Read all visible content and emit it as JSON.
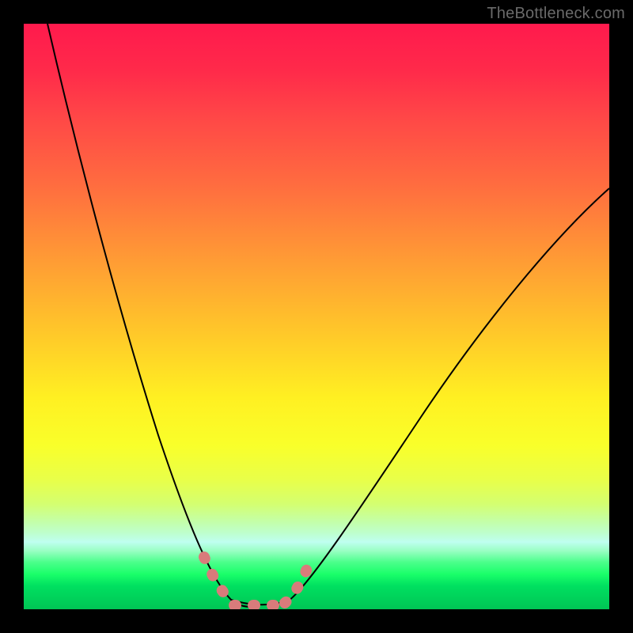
{
  "watermark": "TheBottleneck.com",
  "colors": {
    "frame": "#000000",
    "curve": "#000000",
    "highlight": "#d97b7b",
    "gradient_top": "#ff1a4d",
    "gradient_mid": "#fff022",
    "gradient_bottom": "#00c555"
  },
  "chart_data": {
    "type": "line",
    "title": "",
    "xlabel": "",
    "ylabel": "",
    "xlim": [
      0,
      100
    ],
    "ylim": [
      0,
      100
    ],
    "grid": false,
    "legend_position": "none",
    "notes": "Bottleneck-style V-curve on vertical red-to-green gradient. Y≈0 (green) indicates minimal bottleneck. Highlighted zone marks the near-zero flat region around x≈32–44. No axis ticks or numeric labels are rendered in the image; x/y values below are estimated from pixel geometry on a 0–100 normalized scale.",
    "series": [
      {
        "name": "left-curve",
        "x": [
          4,
          7,
          10,
          13,
          17,
          21,
          25,
          29,
          32,
          34,
          36
        ],
        "y": [
          100,
          90,
          78,
          65,
          50,
          36,
          22,
          11,
          4,
          1.5,
          0.5
        ]
      },
      {
        "name": "valley-flat",
        "x": [
          36,
          38,
          40,
          42,
          44
        ],
        "y": [
          0.5,
          0.3,
          0.3,
          0.3,
          0.5
        ]
      },
      {
        "name": "right-curve",
        "x": [
          44,
          48,
          54,
          60,
          68,
          76,
          84,
          92,
          100
        ],
        "y": [
          0.5,
          3,
          9,
          17,
          28,
          40,
          52,
          62,
          72
        ]
      }
    ],
    "highlight_region": {
      "x_start": 30,
      "x_end": 46,
      "description": "dashed pink overlay along curve near valley floor"
    }
  }
}
